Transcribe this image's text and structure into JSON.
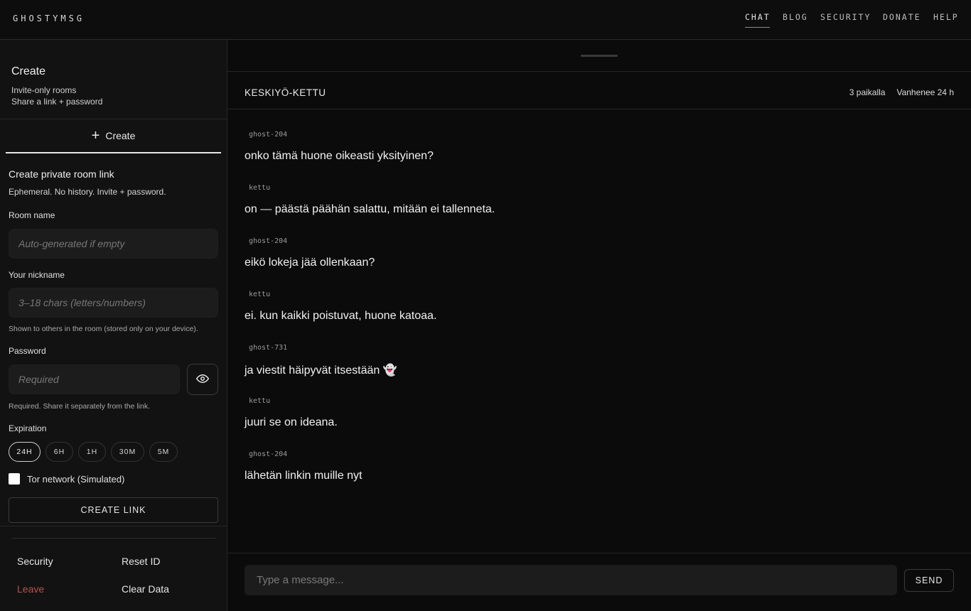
{
  "app": {
    "brand": "GHOSTYMSG"
  },
  "nav": {
    "items": [
      {
        "label": "CHAT",
        "active": true
      },
      {
        "label": "BLOG",
        "active": false
      },
      {
        "label": "SECURITY",
        "active": false
      },
      {
        "label": "DONATE",
        "active": false
      },
      {
        "label": "HELP",
        "active": false
      }
    ]
  },
  "sidebar": {
    "title": "Create",
    "subtitle_1": "Invite-only rooms",
    "subtitle_2": "Share a link + password",
    "tab_label": "Create",
    "form": {
      "title": "Create private room link",
      "subtitle": "Ephemeral. No history. Invite + password.",
      "room_name_label": "Room name",
      "room_name_placeholder": "Auto-generated if empty",
      "nickname_label": "Your nickname",
      "nickname_placeholder": "3–18 chars (letters/numbers)",
      "nickname_hint": "Shown to others in the room (stored only on your device).",
      "password_label": "Password",
      "password_placeholder": "Required",
      "password_hint": "Required. Share it separately from the link.",
      "expiration_label": "Expiration",
      "expiration_options": [
        "24H",
        "6H",
        "1H",
        "30M",
        "5M"
      ],
      "expiration_selected": "24H",
      "tor_label": "Tor network (Simulated)",
      "create_button": "CREATE LINK"
    },
    "footer": {
      "security": "Security",
      "reset_id": "Reset ID",
      "leave": "Leave",
      "clear_data": "Clear Data"
    }
  },
  "room": {
    "name": "KESKIYÖ-KETTU",
    "occupancy": "3 paikalla",
    "expires": "Vanhenee 24 h"
  },
  "messages": [
    {
      "author": "ghost-204",
      "text": "onko tämä huone oikeasti yksityinen?"
    },
    {
      "author": "kettu",
      "text": "on — päästä päähän salattu, mitään ei tallenneta."
    },
    {
      "author": "ghost-204",
      "text": "eikö lokeja jää ollenkaan?"
    },
    {
      "author": "kettu",
      "text": "ei. kun kaikki poistuvat, huone katoaa."
    },
    {
      "author": "ghost-731",
      "text": "ja viestit häipyvät itsestään 👻"
    },
    {
      "author": "kettu",
      "text": "juuri se on ideana."
    },
    {
      "author": "ghost-204",
      "text": "lähetän linkin muille nyt"
    }
  ],
  "composer": {
    "placeholder": "Type a message...",
    "send_label": "SEND"
  },
  "colors": {
    "background": "#0b0b0b",
    "sidebar": "#121212",
    "danger": "#b5524e"
  }
}
